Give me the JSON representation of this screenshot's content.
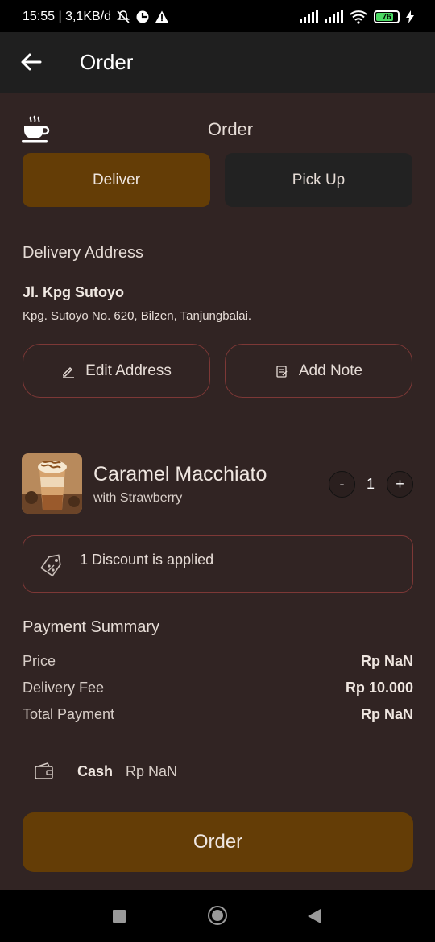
{
  "status_bar": {
    "time_info": "15:55 | 3,1KB/d",
    "battery": "76"
  },
  "app_bar": {
    "title": "Order",
    "back_icon": "arrow-left-icon"
  },
  "header": {
    "icon": "coffee-cup-icon",
    "title": "Order"
  },
  "mode_toggle": {
    "deliver_label": "Deliver",
    "pickup_label": "Pick Up",
    "selected": "Deliver"
  },
  "delivery": {
    "section_label": "Delivery Address",
    "address_name": "Jl. Kpg Sutoyo",
    "address_detail": "Kpg. Sutoyo No. 620, Bilzen, Tanjungbalai.",
    "edit_label": "Edit Address",
    "note_label": "Add Note"
  },
  "item": {
    "name": "Caramel Macchiato",
    "variant": "with Strawberry",
    "quantity": "1",
    "minus_label": "-",
    "plus_label": "+"
  },
  "discount": {
    "text": "1 Discount is applied"
  },
  "payment_summary": {
    "title": "Payment Summary",
    "rows": [
      {
        "label": "Price",
        "value": "Rp NaN"
      },
      {
        "label": "Delivery Fee",
        "value": "Rp 10.000"
      },
      {
        "label": "Total Payment",
        "value": "Rp NaN"
      }
    ]
  },
  "payment_method": {
    "icon": "wallet-icon",
    "method": "Cash",
    "amount": "Rp NaN"
  },
  "order_button": {
    "label": "Order"
  },
  "colors": {
    "background": "#312423",
    "accent": "#643d06",
    "outline": "#7d3836",
    "app_bar": "#1f1f1f"
  }
}
